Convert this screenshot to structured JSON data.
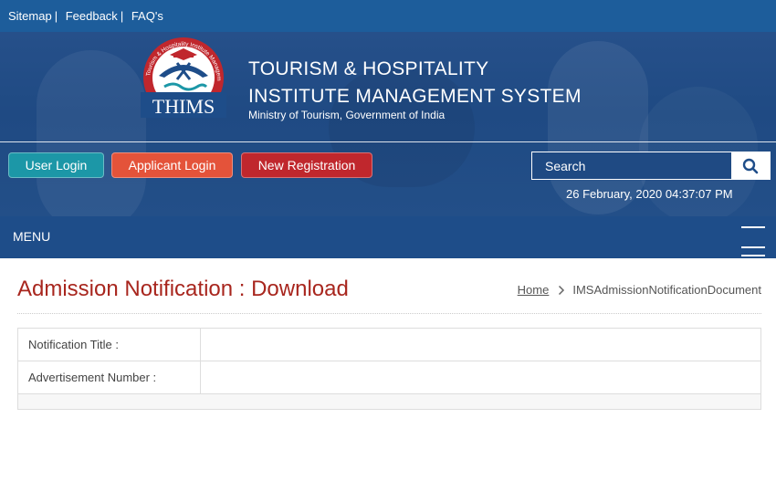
{
  "topbar": {
    "links": [
      {
        "label": "Sitemap"
      },
      {
        "label": "Feedback"
      },
      {
        "label": "FAQ's"
      }
    ]
  },
  "header": {
    "logo_text": "THIMS",
    "logo_ring_text": "Tourism & Hospitality Institute Management System",
    "title_line1": "TOURISM & HOSPITALITY",
    "title_line2": "INSTITUTE MANAGEMENT SYSTEM",
    "subtitle": "Ministry of Tourism, Government of India",
    "buttons": {
      "user_login": "User Login",
      "applicant_login": "Applicant Login",
      "new_registration": "New Registration"
    },
    "search": {
      "placeholder": "Search",
      "value": ""
    },
    "datetime": "26 February, 2020 04:37:07 PM"
  },
  "menu": {
    "label": "MENU"
  },
  "main": {
    "page_title": "Admission Notification : Download",
    "breadcrumb": {
      "home": "Home",
      "current": "IMSAdmissionNotificationDocument"
    },
    "table": {
      "rows": [
        {
          "label": "Notification Title :",
          "value": ""
        },
        {
          "label": "Advertisement Number :",
          "value": ""
        }
      ]
    }
  },
  "colors": {
    "topbar": "#1d5d9b",
    "header": "#234f88",
    "menubar": "#1e4d89",
    "user_login": "#1c97a7",
    "applicant_login": "#e4533a",
    "new_registration": "#c0272d",
    "page_title": "#a8261e"
  },
  "icons": {
    "search": "magnifier-icon",
    "menu": "hamburger-icon",
    "breadcrumb_separator": "chevron-right-icon"
  }
}
